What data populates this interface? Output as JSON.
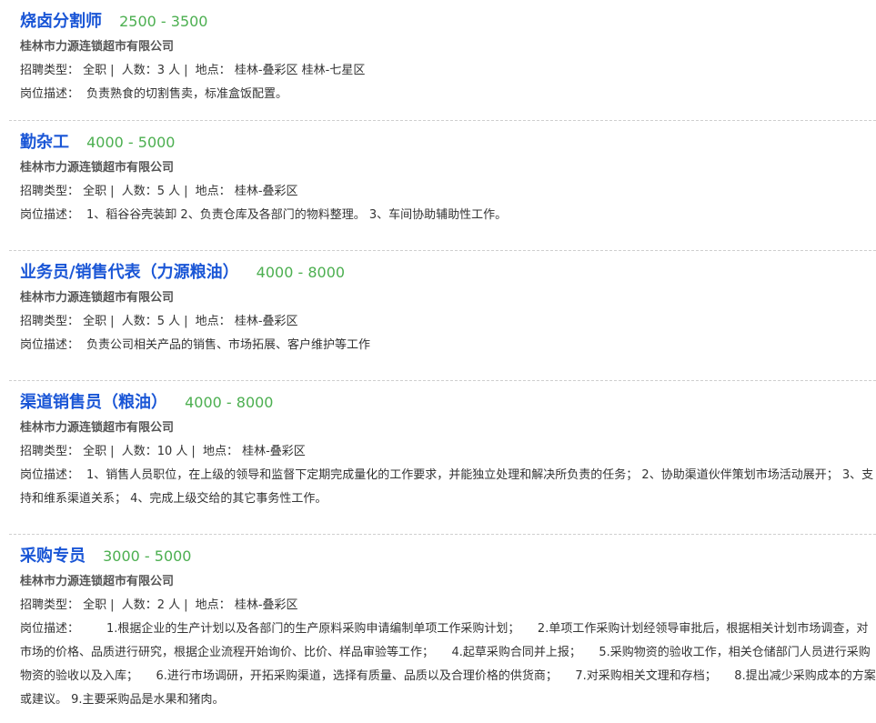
{
  "jobs": [
    {
      "title": "烧卤分割师",
      "salary": "2500 - 3500",
      "company": "桂林市力源连锁超市有限公司",
      "type_label": "招聘类型：",
      "type": "全职",
      "count_label": "人数：",
      "count": "3 人",
      "location_label": "地点：",
      "location": "桂林-叠彩区 桂林-七星区",
      "desc_label": "岗位描述：",
      "desc": "负责熟食的切割售卖，标准盒饭配置。"
    },
    {
      "title": "勤杂工",
      "salary": "4000 - 5000",
      "company": "桂林市力源连锁超市有限公司",
      "type_label": "招聘类型：",
      "type": "全职",
      "count_label": "人数：",
      "count": "5 人",
      "location_label": "地点：",
      "location": "桂林-叠彩区",
      "desc_label": "岗位描述：",
      "desc": "1、稻谷谷壳装卸 2、负责仓库及各部门的物料整理。 3、车间协助辅助性工作。"
    },
    {
      "title": "业务员/销售代表（力源粮油）",
      "salary": "4000 - 8000",
      "company": "桂林市力源连锁超市有限公司",
      "type_label": "招聘类型：",
      "type": "全职",
      "count_label": "人数：",
      "count": "5 人",
      "location_label": "地点：",
      "location": "桂林-叠彩区",
      "desc_label": "岗位描述：",
      "desc": "负责公司相关产品的销售、市场拓展、客户维护等工作"
    },
    {
      "title": "渠道销售员（粮油）",
      "salary": "4000 - 8000",
      "company": "桂林市力源连锁超市有限公司",
      "type_label": "招聘类型：",
      "type": "全职",
      "count_label": "人数：",
      "count": "10 人",
      "location_label": "地点：",
      "location": "桂林-叠彩区",
      "desc_label": "岗位描述：",
      "desc": "1、销售人员职位，在上级的领导和监督下定期完成量化的工作要求，并能独立处理和解决所负责的任务； 2、协助渠道伙伴策划市场活动展开； 3、支持和维系渠道关系； 4、完成上级交给的其它事务性工作。"
    },
    {
      "title": "采购专员",
      "salary": "3000 - 5000",
      "company": "桂林市力源连锁超市有限公司",
      "type_label": "招聘类型：",
      "type": "全职",
      "count_label": "人数：",
      "count": "2 人",
      "location_label": "地点：",
      "location": "桂林-叠彩区",
      "desc_label": "岗位描述：",
      "desc": "1.根据企业的生产计划以及各部门的生产原料采购申请编制单项工作采购计划；　　2.单项工作采购计划经领导审批后，根据相关计划市场调查，对市场的价格、品质进行研究，根据企业流程开始询价、比价、样品审验等工作；　　4.起草采购合同并上报；　　5.采购物资的验收工作，相关仓储部门人员进行采购物资的验收以及入库；　　6.进行市场调研，开拓采购渠道，选择有质量、品质以及合理价格的供货商；　　7.对采购相关文理和存档；　　8.提出减少采购成本的方案或建议。 9.主要采购品是水果和猪肉。"
    }
  ]
}
